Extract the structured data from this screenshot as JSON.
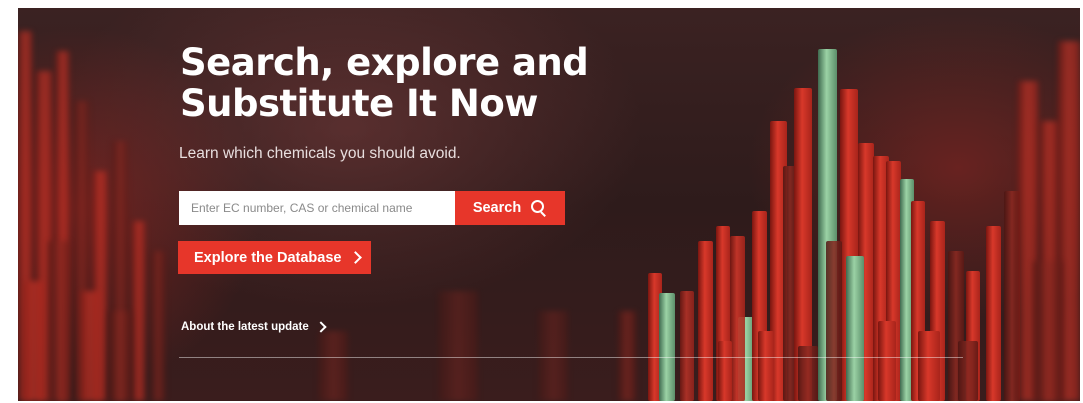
{
  "hero": {
    "title": "Search, explore and\nSubstitute It Now",
    "subtitle": "Learn which chemicals you should avoid.",
    "background_icon": "chemical-bars-visual",
    "accent_color": "#e7362a"
  },
  "search": {
    "value": "",
    "placeholder": "Enter EC number, CAS or chemical name",
    "button_label": "Search",
    "button_icon": "search-icon"
  },
  "explore": {
    "label": "Explore the Database",
    "icon": "chevron-right-icon"
  },
  "update_link": {
    "label": "About the latest update",
    "icon": "chevron-right-icon"
  }
}
